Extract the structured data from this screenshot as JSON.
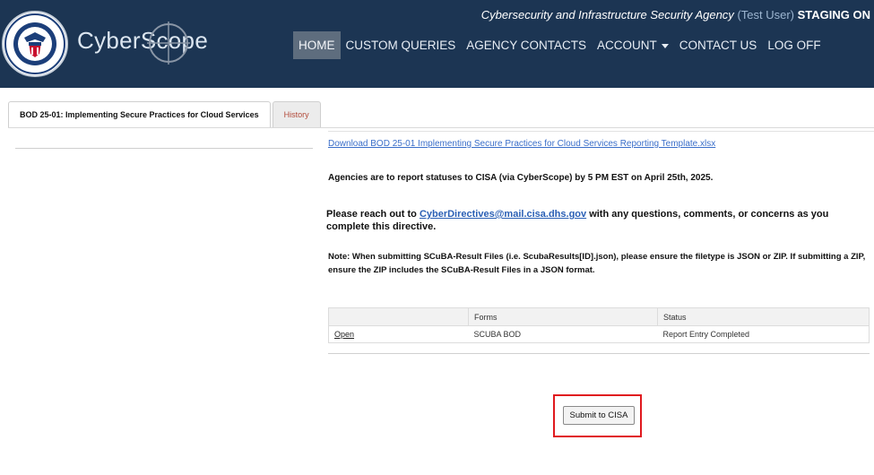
{
  "header": {
    "brand": "CyberScope",
    "agency": "Cybersecurity and Infrastructure Security Agency",
    "user": "(Test User)",
    "environment": "STAGING ON",
    "colors": {
      "background": "#1c3553",
      "active_nav": "#5e6d7e"
    },
    "logo_icon": "dhs-seal-icon"
  },
  "nav": {
    "items": [
      {
        "label": "HOME",
        "active": true
      },
      {
        "label": "CUSTOM QUERIES"
      },
      {
        "label": "AGENCY CONTACTS"
      },
      {
        "label": "ACCOUNT",
        "dropdown": true
      },
      {
        "label": "CONTACT US"
      },
      {
        "label": "LOG OFF"
      }
    ]
  },
  "tabs": [
    {
      "label": "BOD 25-01: Implementing Secure Practices for Cloud Services",
      "active": true
    },
    {
      "label": "History"
    }
  ],
  "content": {
    "download_link": "Download BOD 25-01 Implementing Secure Practices for Cloud Services Reporting Template.xlsx",
    "deadline": "Agencies are to report statuses to CISA (via CyberScope) by 5 PM EST on April 25th, 2025.",
    "reach_prefix": "Please reach out to ",
    "reach_email": "CyberDirectives@mail.cisa.dhs.gov",
    "reach_suffix": " with any questions, comments, or concerns as you complete this directive.",
    "note": "Note: When submitting SCuBA-Result Files (i.e. ScubaResults[ID].json), please ensure the filetype is JSON or ZIP. If submitting a ZIP, ensure the ZIP includes the SCuBA-Result Files in a JSON format."
  },
  "table": {
    "columns": [
      "",
      "Forms",
      "Status"
    ],
    "rows": [
      {
        "action": "Open",
        "form": "SCUBA BOD",
        "status": "Report Entry Completed"
      }
    ]
  },
  "submit": {
    "label": "Submit to CISA",
    "highlight_color": "#e0191e"
  }
}
